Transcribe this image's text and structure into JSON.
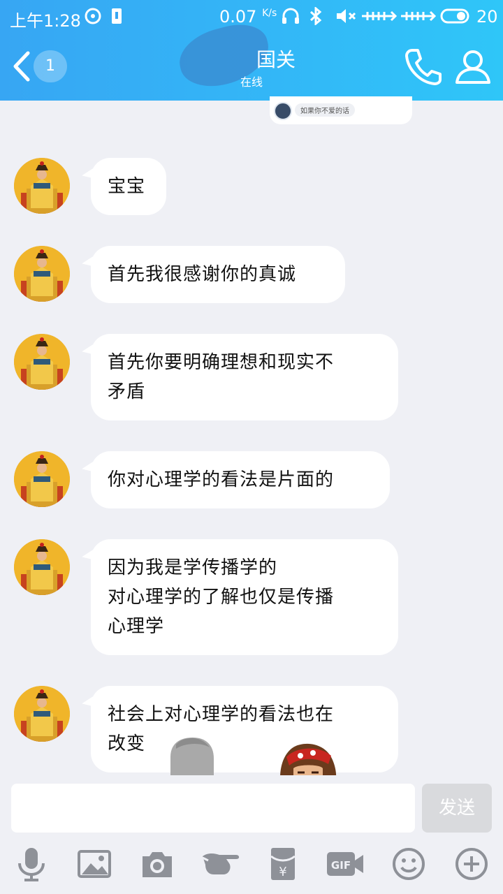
{
  "status_bar": {
    "time": "上午1:28",
    "net_speed": "0.07",
    "net_unit": "K/s",
    "battery": "20",
    "icons": [
      "app-icon",
      "sim-icon",
      "headphones-icon",
      "bluetooth-icon",
      "mute-icon",
      "signal-icon",
      "signal-icon",
      "battery-icon"
    ]
  },
  "header": {
    "unread_count": "1",
    "title": "国关",
    "subtitle": "在线",
    "buttons": [
      "phone-icon",
      "profile-icon"
    ],
    "accent": "#36aef5"
  },
  "previous_card": {
    "text": "如果你不爱的话"
  },
  "messages": [
    {
      "text": "宝宝"
    },
    {
      "text": "首先我很感谢你的真诚"
    },
    {
      "text": "首先你要明确理想和现实不\n矛盾"
    },
    {
      "text": "你对心理学的看法是片面的"
    },
    {
      "text": "因为我是学传播学的\n对心理学的了解也仅是传播\n心理学"
    },
    {
      "text": "社会上对心理学的看法也在\n改变"
    }
  ],
  "input": {
    "value": "",
    "send_label": "发送"
  },
  "toolbar": {
    "items": [
      "microphone-icon",
      "image-icon",
      "camera-icon",
      "poke-icon",
      "red-packet-icon",
      "gif-icon",
      "emoji-icon",
      "plus-icon"
    ]
  }
}
